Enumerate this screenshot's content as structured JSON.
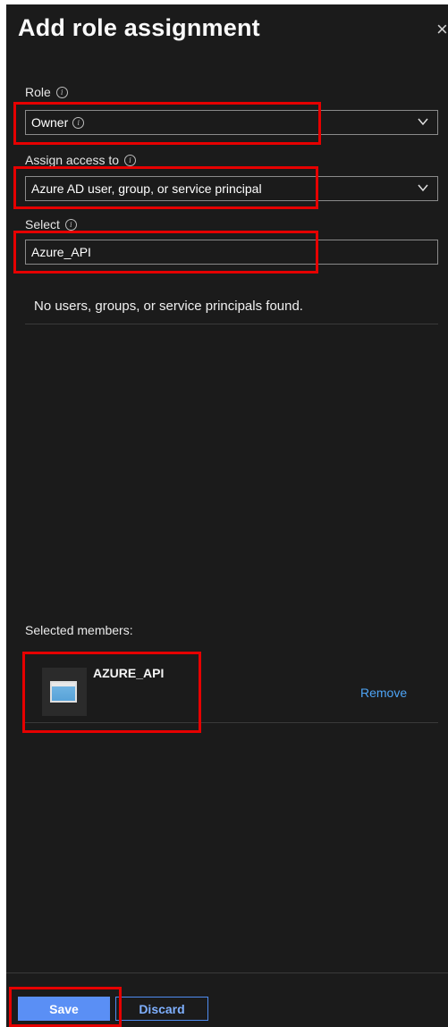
{
  "panel": {
    "title": "Add role assignment",
    "close_glyph": "×"
  },
  "role": {
    "label": "Role",
    "value": "Owner"
  },
  "assign_access": {
    "label": "Assign access to",
    "value": "Azure AD user, group, or service principal"
  },
  "select": {
    "label": "Select",
    "value": "Azure_API"
  },
  "results": {
    "empty_message": "No users, groups, or service principals found."
  },
  "selected_members": {
    "label": "Selected members:",
    "items": [
      {
        "name": "AZURE_API",
        "remove_label": "Remove",
        "icon": "app-window-icon"
      }
    ]
  },
  "footer": {
    "save_label": "Save",
    "discard_label": "Discard"
  },
  "colors": {
    "background": "#1b1b1b",
    "accent": "#5a8ff5",
    "link": "#4ea4f5",
    "highlight": "#e60000"
  }
}
